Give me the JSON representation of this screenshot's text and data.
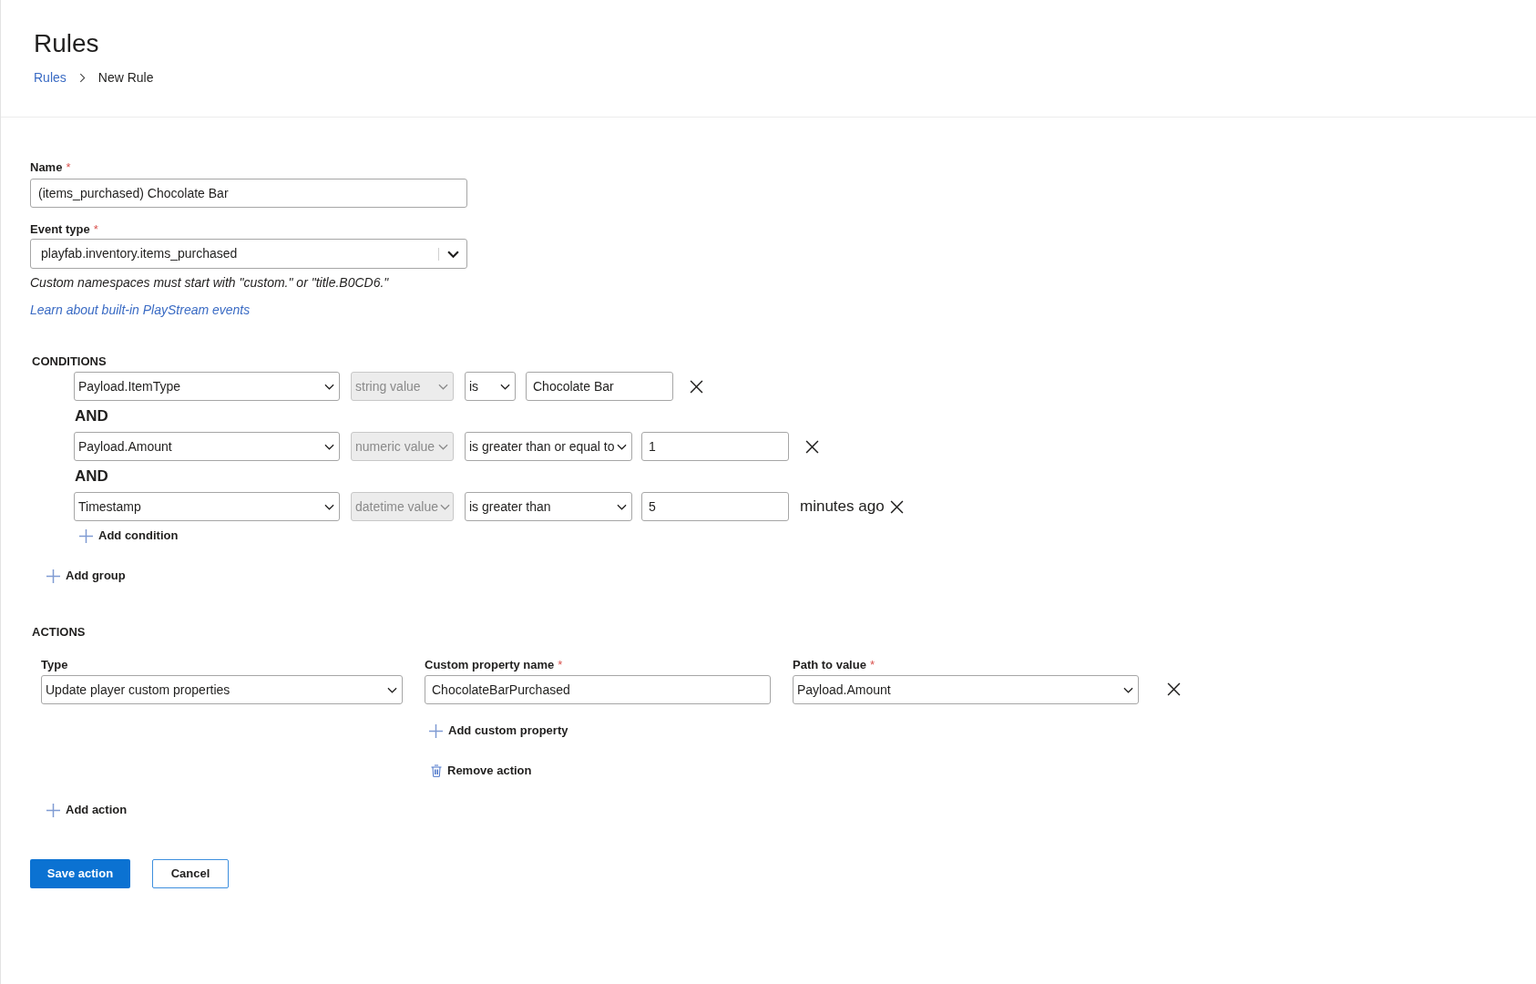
{
  "header": {
    "title": "Rules",
    "breadcrumb": [
      {
        "label": "Rules",
        "kind": "link"
      },
      {
        "label": "New Rule",
        "kind": "current"
      }
    ]
  },
  "rule": {
    "name": {
      "label": "Name",
      "required_mark": "*",
      "value": "(items_purchased) Chocolate Bar"
    },
    "event_type": {
      "label": "Event type",
      "required_mark": "*",
      "value": "playfab.inventory.items_purchased",
      "hint": "Custom namespaces must start with \"custom.\" or \"title.B0CD6.\"",
      "link": "Learn about built-in PlayStream events"
    }
  },
  "conditions": {
    "heading": "CONDITIONS",
    "rows": [
      {
        "field": "Payload.ItemType",
        "value_type": {
          "value": "string value",
          "disabled": true
        },
        "operator": "is",
        "value": "Chocolate Bar"
      },
      {
        "joiner": "AND",
        "field": "Payload.Amount",
        "value_type": {
          "value": "numeric value",
          "disabled": true
        },
        "operator": "is greater than or equal to",
        "value": "1"
      },
      {
        "joiner": "AND",
        "field": "Timestamp",
        "value_type": {
          "value": "datetime value",
          "disabled": true
        },
        "operator": "is greater than",
        "value": "5",
        "suffix": "minutes ago"
      }
    ],
    "add_condition": "Add condition",
    "add_group": "Add group"
  },
  "actions": {
    "heading": "ACTIONS",
    "items": [
      {
        "type": {
          "label": "Type",
          "value": "Update player custom properties"
        },
        "property_name": {
          "label": "Custom property name",
          "required_mark": "*",
          "value": "ChocolateBarPurchased"
        },
        "path": {
          "label": "Path to value",
          "required_mark": "*",
          "value": "Payload.Amount"
        },
        "add_property": "Add custom property",
        "remove": "Remove action"
      }
    ],
    "add_action": "Add action"
  },
  "buttons": [
    {
      "label": "Save action",
      "kind": "primary"
    },
    {
      "label": "Cancel",
      "kind": "secondary"
    }
  ]
}
